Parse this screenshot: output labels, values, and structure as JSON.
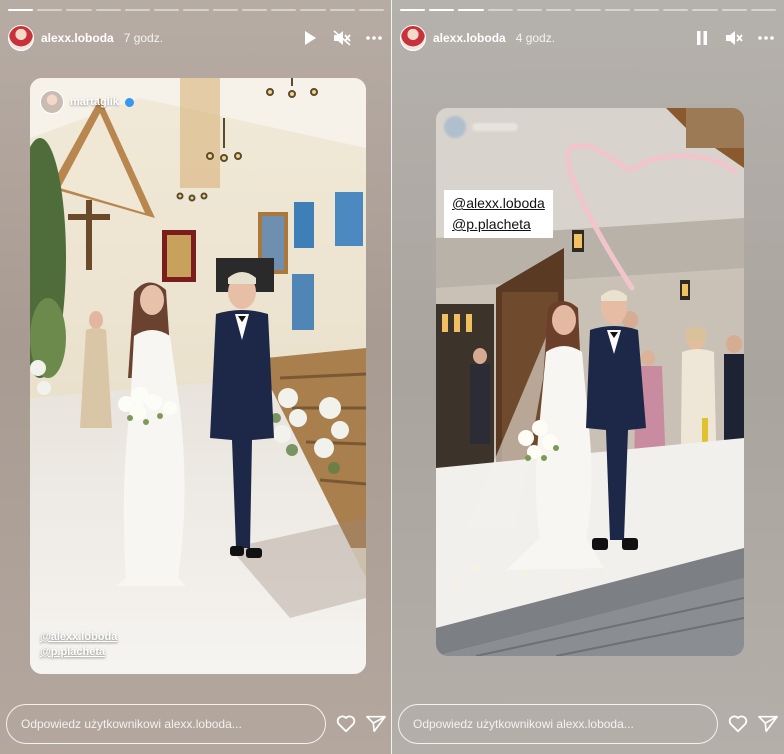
{
  "left_story": {
    "username": "alexx.loboda",
    "time": "7 godz.",
    "progress_total": 13,
    "progress_done": 1,
    "playback_icon": "play-icon",
    "sound_icon": "muted-icon",
    "mention_user": "martaglik",
    "tags": [
      "@alexx.loboda",
      "@p.placheta"
    ],
    "reply_placeholder": "Odpowiedz użytkownikowi alexx.loboda..."
  },
  "right_story": {
    "username": "alexx.loboda",
    "time": "4 godz.",
    "progress_total": 13,
    "progress_done": 3,
    "playback_icon": "pause-icon",
    "sound_icon": "muted-icon",
    "tags": [
      "@alexx.loboda",
      "@p.placheta"
    ],
    "sticker": "heart-doodle",
    "reply_placeholder": "Odpowiedz użytkownikowi alexx.loboda..."
  },
  "colors": {
    "verified": "#3897f0",
    "heart_doodle": "#f2c4cc"
  }
}
